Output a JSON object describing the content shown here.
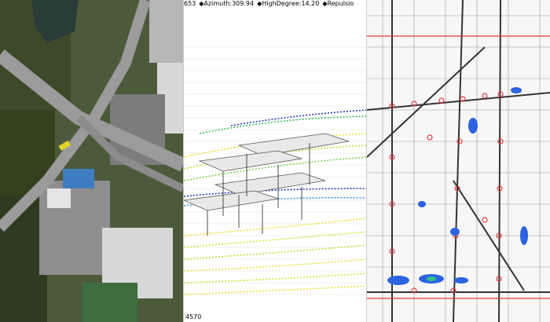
{
  "panels": {
    "aerial": {
      "name": "aerial photo"
    },
    "simulation": {
      "hud_items": [
        "653",
        "◆Azimuth:309.94",
        "◆HighDegree:14.20",
        "◆Repulsio"
      ],
      "footer": "4570"
    },
    "map": {
      "name": "street map with points"
    }
  },
  "colors": {
    "tree": "#3a4a28",
    "road": "#9a9a9a",
    "roof": "#c9c9c9",
    "stream_low": "#1f2fbf",
    "stream_mid": "#2fbf4f",
    "stream_high": "#e8e02f",
    "map_red": "#e13b3b",
    "map_blue": "#2b63e0"
  }
}
